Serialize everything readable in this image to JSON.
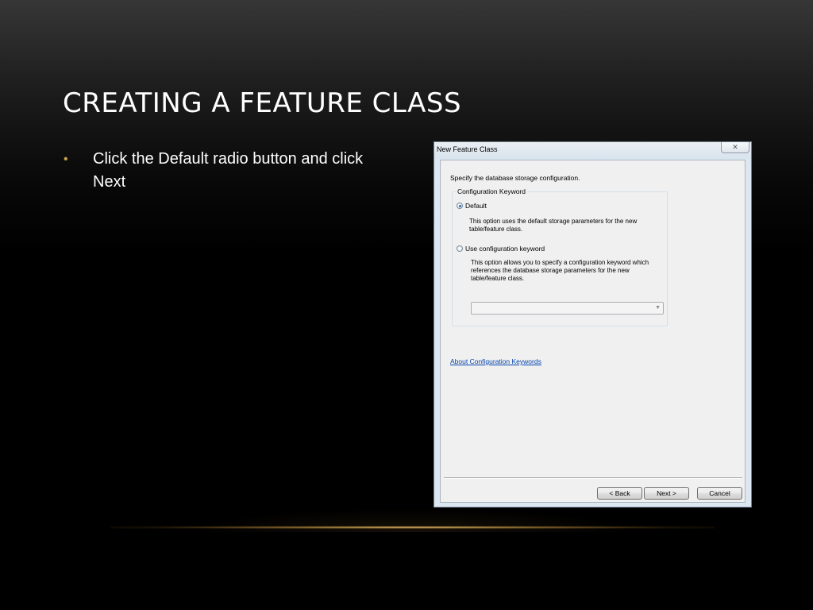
{
  "slide": {
    "title": "CREATING A FEATURE CLASS",
    "bullet_marker": "•",
    "bullet_text": "Click the Default radio button and click Next",
    "accent_color": "#c9a24b"
  },
  "dialog": {
    "title": "New Feature Class",
    "close_icon": "close-icon",
    "close_glyph": "✕",
    "instruction": "Specify the database storage configuration.",
    "group_label": "Configuration Keyword",
    "options": [
      {
        "label": "Default",
        "checked": true,
        "description": "This option uses the default storage parameters for the new table/feature class."
      },
      {
        "label": "Use configuration keyword",
        "checked": false,
        "description": "This option allows you to specify a configuration keyword which references the database storage parameters for the new table/feature class."
      }
    ],
    "keyword_select_value": "",
    "select_arrow": "▼",
    "help_link": "About Configuration Keywords",
    "buttons": {
      "back": "< Back",
      "next": "Next >",
      "cancel": "Cancel"
    }
  }
}
